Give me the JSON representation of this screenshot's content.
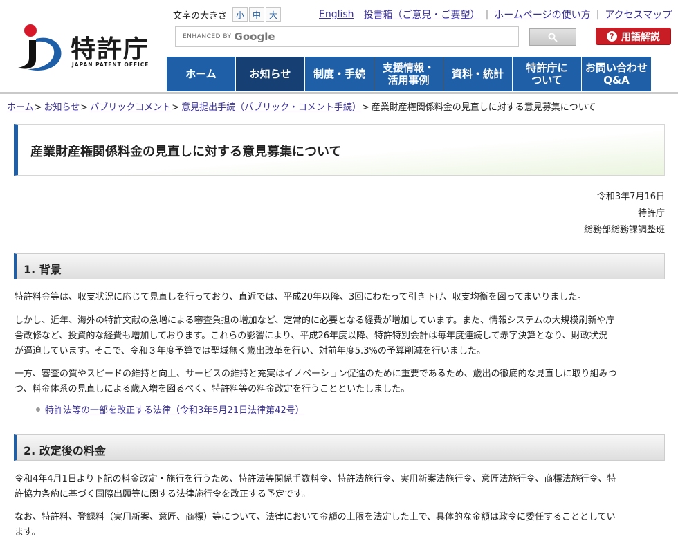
{
  "logo": {
    "name": "特許庁",
    "sub": "JAPAN PATENT OFFICE"
  },
  "font_size": {
    "label": "文字の大きさ",
    "small": "小",
    "medium": "中",
    "large": "大"
  },
  "top_links": [
    "English",
    "投書箱（ご意見・ご要望）",
    "ホームページの使い方",
    "アクセスマップ"
  ],
  "search": {
    "enhanced_by": "ENHANCED BY",
    "provider": "Google"
  },
  "glossary": {
    "icon": "?",
    "label": "用語解説"
  },
  "nav": [
    {
      "line1": "ホーム",
      "line2": ""
    },
    {
      "line1": "お知らせ",
      "line2": ""
    },
    {
      "line1": "制度・手続",
      "line2": ""
    },
    {
      "line1": "支援情報・",
      "line2": "活用事例"
    },
    {
      "line1": "資料・統計",
      "line2": ""
    },
    {
      "line1": "特許庁に",
      "line2": "ついて"
    },
    {
      "line1": "お問い合わせ",
      "line2": "Q&A"
    }
  ],
  "breadcrumb": {
    "links": [
      "ホーム",
      "お知らせ",
      "パブリックコメント",
      "意見提出手続（パブリック・コメント手続）"
    ],
    "separator": ">",
    "current": "産業財産権関係料金の見直しに対する意見募集について"
  },
  "page_title": "産業財産権関係料金の見直しに対する意見募集について",
  "signature": {
    "date": "令和3年7月16日",
    "office": "特許庁",
    "department": "総務部総務課調整班"
  },
  "sections": {
    "s1": {
      "heading": "1. 背景",
      "p1": "特許料金等は、収支状況に応じて見直しを行っており、直近では、平成20年以降、3回にわたって引き下げ、収支均衡を図ってまいりました。",
      "p2_l1": "しかし、近年、海外の特許文献の急増による審査負担の増加など、定常的に必要となる経費が増加しています。また、情報システムの大規模刷新や庁",
      "p2_l2": "舎改修など、投資的な経費も増加しております。これらの影響により、平成26年度以降、特許特別会計は毎年度連続して赤字決算となり、財政状況",
      "p2_l3": "が逼迫しています。そこで、令和３年度予算では聖域無く歳出改革を行い、対前年度5.3%の予算削減を行いました。",
      "p3_l1": "一方、審査の質やスピードの維持と向上、サービスの維持と充実はイノベーション促進のために重要であるため、歳出の徹底的な見直しに取り組みつ",
      "p3_l2": "つ、料金体系の見直しによる歳入増を図るべく、特許料等の料金改定を行うことといたしました。",
      "link": "特許法等の一部を改正する法律（令和3年5月21日法律第42号）"
    },
    "s2": {
      "heading": "2. 改定後の料金",
      "p1_l1": "令和4年4月1日より下記の料金改定・施行を行うため、特許法等関係手数料令、特許法施行令、実用新案法施行令、意匠法施行令、商標法施行令、特",
      "p1_l2": "許協力条約に基づく国際出願等に関する法律施行令を改正する予定です。",
      "p2_l1": "なお、特許料、登録料（実用新案、意匠、商標）等について、法律において金額の上限を法定した上で、具体的な金額は政令に委任することとしてい",
      "p2_l2": "ます。"
    }
  },
  "colors": {
    "nav_blue": "#1e5fa8",
    "nav_active": "#163f73",
    "glossary_red": "#c81d25",
    "link": "#3b3296"
  }
}
